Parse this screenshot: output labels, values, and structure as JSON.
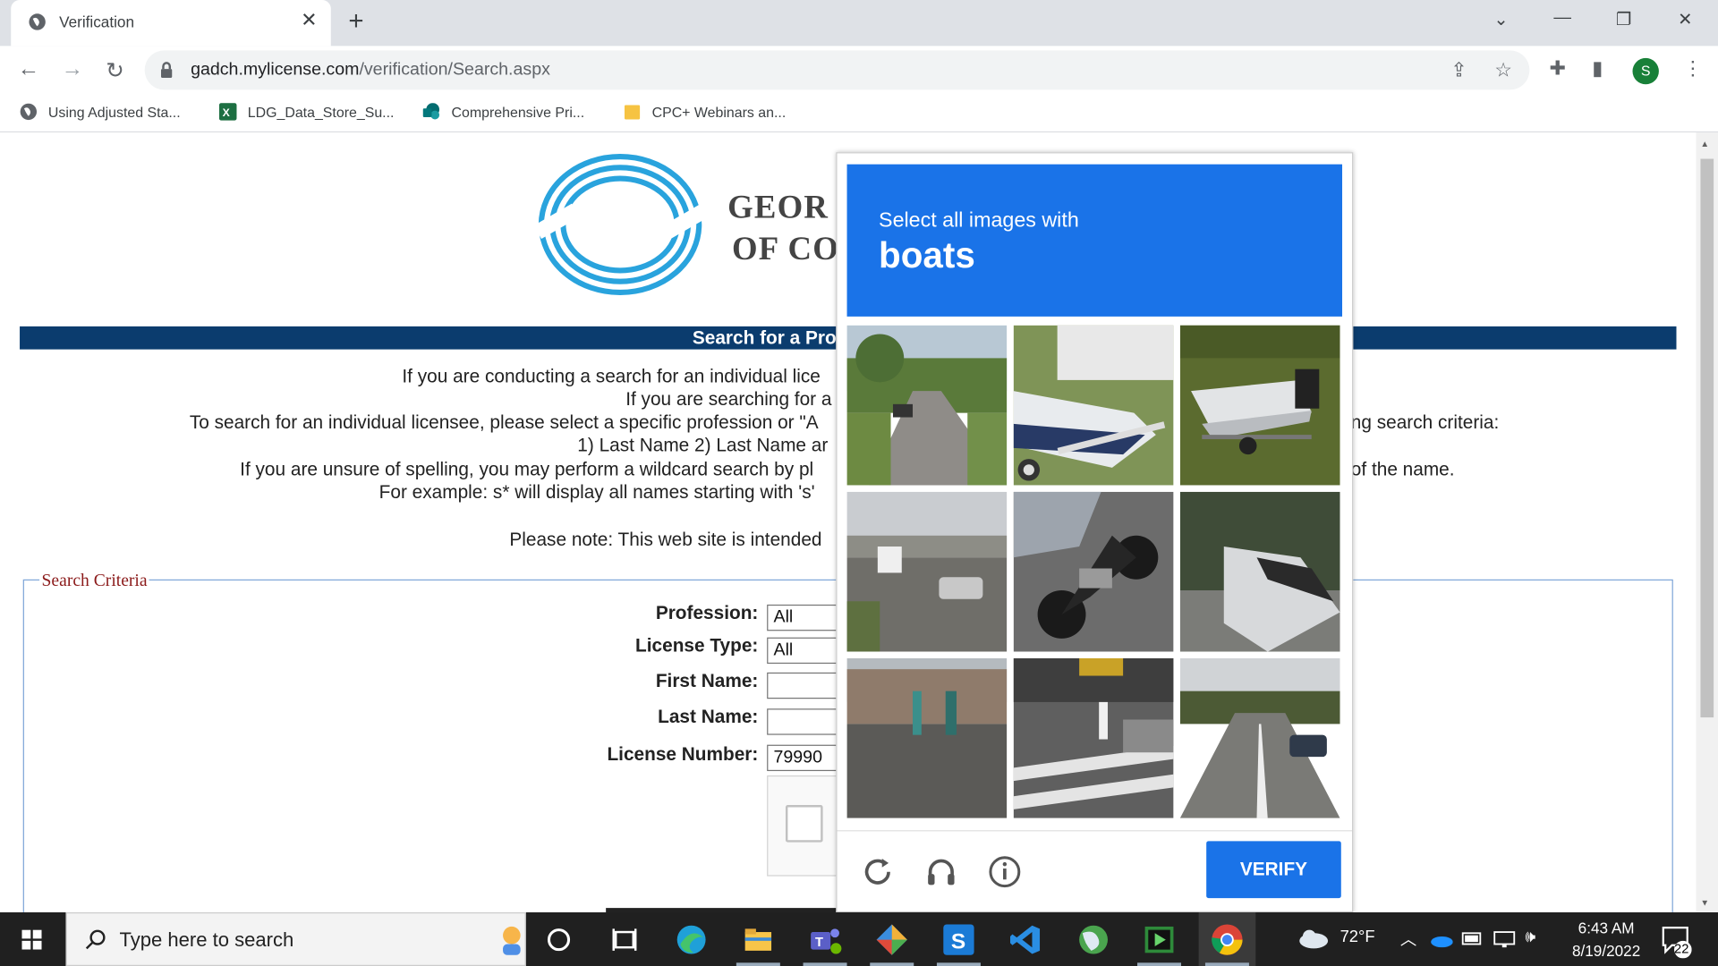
{
  "browser": {
    "tab_title": "Verification",
    "new_tab_symbol": "+",
    "url_host": "gadch.mylicense.com",
    "url_path": "/verification/Search.aspx",
    "profile_initial": "S",
    "bookmarks": [
      {
        "label": "Using Adjusted Sta..."
      },
      {
        "label": "LDG_Data_Store_Su..."
      },
      {
        "label": "Comprehensive Pri..."
      },
      {
        "label": "CPC+ Webinars an..."
      }
    ]
  },
  "page": {
    "logo_line1": "GEOR",
    "logo_line2": "OF CO",
    "banner_title": "Search for a Pro",
    "intro_lines": [
      "If you are conducting a search for an individual lice",
      "If you are searching for a",
      "To search for an individual licensee, please select a specific profession or \"A",
      "ng search criteria:",
      "1) Last Name 2) Last Name ar",
      "If you are unsure of spelling, you may perform a wildcard search by pl",
      "of the name.",
      "For example: s* will display all names starting with 's'",
      "Please note: This web site is intended"
    ],
    "search_legend": "Search Criteria",
    "form": {
      "profession_label": "Profession:",
      "profession_value": "All",
      "license_type_label": "License Type:",
      "license_type_value": "All",
      "first_name_label": "First Name:",
      "first_name_value": "",
      "last_name_label": "Last Name:",
      "last_name_value": "",
      "license_number_label": "License Number:",
      "license_number_value": "79990"
    }
  },
  "captcha": {
    "instruction": "Select all images with",
    "target": "boats",
    "verify_label": "VERIFY",
    "tiles": [
      {
        "desc": "street"
      },
      {
        "desc": "boat"
      },
      {
        "desc": "boat"
      },
      {
        "desc": "highway"
      },
      {
        "desc": "motorcycle"
      },
      {
        "desc": "boat"
      },
      {
        "desc": "sidewalk"
      },
      {
        "desc": "crosswalk"
      },
      {
        "desc": "road"
      }
    ],
    "colors": {
      "accent": "#1a73e8"
    }
  },
  "taskbar": {
    "search_placeholder": "Type here to search",
    "weather": "72°F",
    "time": "6:43 AM",
    "date": "8/19/2022",
    "notifications": "22"
  }
}
